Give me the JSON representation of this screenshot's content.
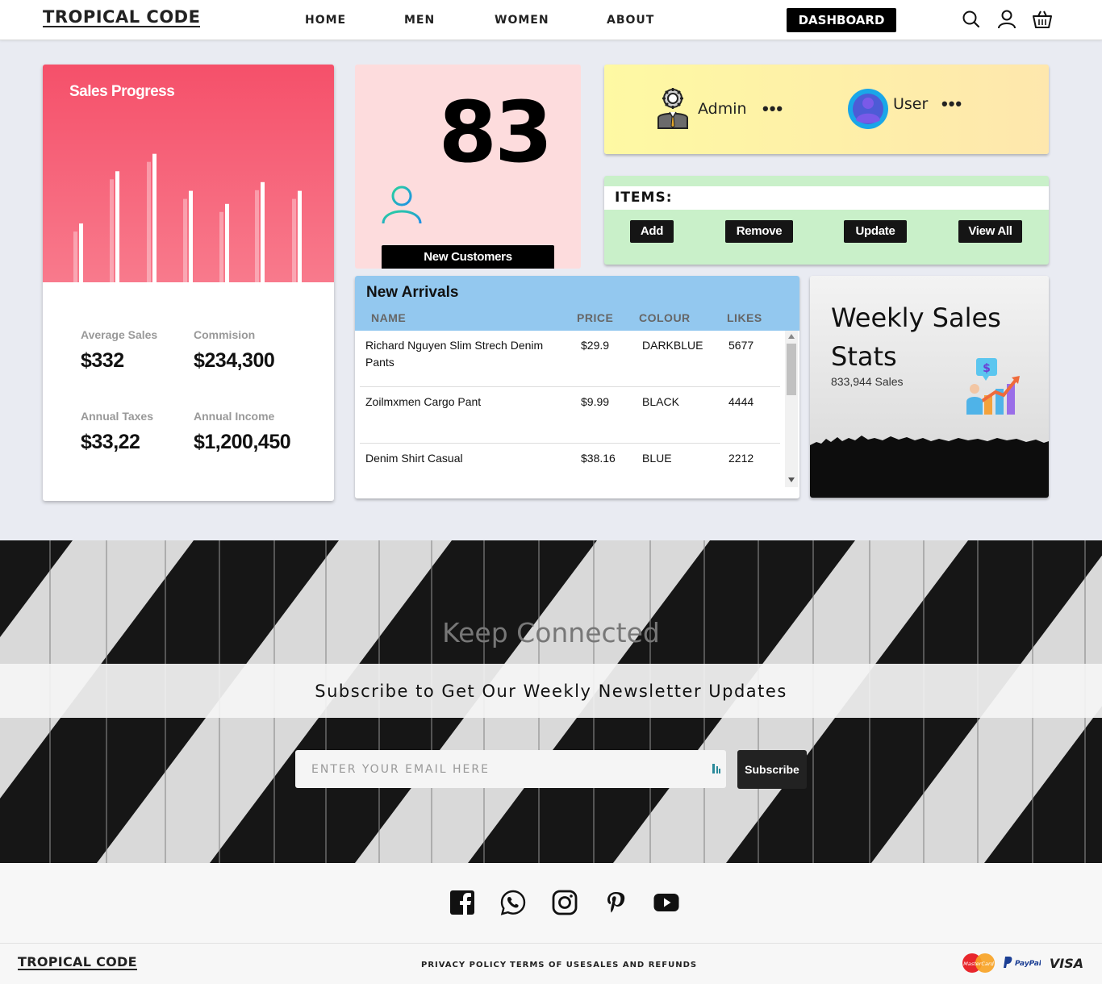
{
  "nav": {
    "logo": "TROPICAL CODE",
    "links": [
      "HOME",
      "MEN",
      "WOMEN",
      "ABOUT"
    ],
    "dashboard": "DASHBOARD",
    "icons": [
      "search-icon",
      "user-icon",
      "basket-icon"
    ]
  },
  "sales": {
    "title": "Sales Progress",
    "bars": [
      0.27,
      0.51,
      0.59,
      0.42,
      0.36,
      0.46,
      0.42
    ],
    "stats": [
      {
        "label": "Average Sales",
        "value": "$332"
      },
      {
        "label": "Commision",
        "value": "$234,300"
      },
      {
        "label": "Annual Taxes",
        "value": "$33,22"
      },
      {
        "label": "Annual Income",
        "value": "$1,200,450"
      }
    ]
  },
  "customers": {
    "count": "83",
    "label": "New Customers"
  },
  "roles": {
    "admin": "Admin",
    "user": "User",
    "more": "•••"
  },
  "items": {
    "title": "ITEMS:",
    "buttons": [
      "Add",
      "Remove",
      "Update",
      "View All"
    ]
  },
  "arrivals": {
    "title": "New Arrivals",
    "columns": [
      "NAME",
      "PRICE",
      "COLOUR",
      "LIKES"
    ],
    "rows": [
      {
        "name": "Richard Nguyen Slim Strech Denim Pants",
        "price": "$29.9",
        "colour": "DARKBLUE",
        "likes": "5677"
      },
      {
        "name": "Zoilmxmen Cargo Pant",
        "price": "$9.99",
        "colour": "BLACK",
        "likes": "4444"
      },
      {
        "name": "Denim Shirt Casual",
        "price": "$38.16",
        "colour": "BLUE",
        "likes": "2212"
      }
    ]
  },
  "weekly": {
    "title": "Weekly Sales Stats",
    "sub": "833,944 Sales"
  },
  "newsletter": {
    "title": "Keep Connected",
    "subtitle": "Subscribe to Get Our Weekly Newsletter Updates",
    "placeholder": "ENTER YOUR EMAIL HERE",
    "button": "Subscribe"
  },
  "footer": {
    "social": [
      "facebook-icon",
      "whatsapp-icon",
      "instagram-icon",
      "pinterest-icon",
      "youtube-icon"
    ],
    "logo": "TROPICAL CODE",
    "links": [
      "PRIVACY POLICY",
      "TERMS OF USE",
      "SALES AND REFUNDS"
    ],
    "payments": [
      "MasterCard",
      "PayPal",
      "VISA"
    ]
  },
  "colors": {
    "sales_gradient_top": "#f5506a",
    "customers_bg": "#fddcdd",
    "roles_bg": "#fef9a3",
    "items_bg": "#c9f0c9",
    "arrivals_header": "#93c8ef"
  }
}
